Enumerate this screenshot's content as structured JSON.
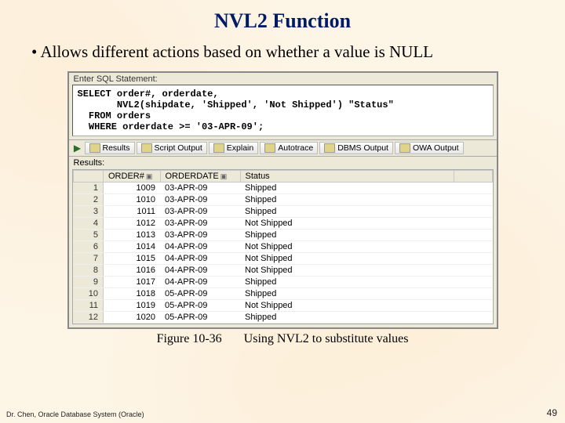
{
  "title": "NVL2 Function",
  "bullet": "•  Allows different actions based on whether a value is NULL",
  "sql_panel_label": "Enter SQL Statement:",
  "sql": {
    "l1a": "SELECT",
    "l1b": " order#, orderdate,",
    "l2": "       NVL2(shipdate, 'Shipped', 'Not Shipped') \"Status\"",
    "l3a": "  FROM",
    "l3b": " orders",
    "l4a": "  WHERE",
    "l4b": " orderdate >= '03-APR-09';"
  },
  "tabs": {
    "results": "Results",
    "script": "Script Output",
    "explain": "Explain",
    "autotrace": "Autotrace",
    "dbms": "DBMS Output",
    "owa": "OWA Output"
  },
  "results_label": "Results:",
  "columns": {
    "c1": "ORDER#",
    "c2": "ORDERDATE",
    "c3": "Status"
  },
  "rows": [
    {
      "n": "1",
      "order": "1009",
      "date": "03-APR-09",
      "status": "Shipped"
    },
    {
      "n": "2",
      "order": "1010",
      "date": "03-APR-09",
      "status": "Shipped"
    },
    {
      "n": "3",
      "order": "1011",
      "date": "03-APR-09",
      "status": "Shipped"
    },
    {
      "n": "4",
      "order": "1012",
      "date": "03-APR-09",
      "status": "Not Shipped"
    },
    {
      "n": "5",
      "order": "1013",
      "date": "03-APR-09",
      "status": "Shipped"
    },
    {
      "n": "6",
      "order": "1014",
      "date": "04-APR-09",
      "status": "Not Shipped"
    },
    {
      "n": "7",
      "order": "1015",
      "date": "04-APR-09",
      "status": "Not Shipped"
    },
    {
      "n": "8",
      "order": "1016",
      "date": "04-APR-09",
      "status": "Not Shipped"
    },
    {
      "n": "9",
      "order": "1017",
      "date": "04-APR-09",
      "status": "Shipped"
    },
    {
      "n": "10",
      "order": "1018",
      "date": "05-APR-09",
      "status": "Shipped"
    },
    {
      "n": "11",
      "order": "1019",
      "date": "05-APR-09",
      "status": "Not Shipped"
    },
    {
      "n": "12",
      "order": "1020",
      "date": "05-APR-09",
      "status": "Shipped"
    }
  ],
  "caption": {
    "fig": "Figure 10-36",
    "desc": "Using NVL2 to substitute values"
  },
  "footer_left": "Dr. Chen, Oracle Database System (Oracle)",
  "footer_right": "49"
}
